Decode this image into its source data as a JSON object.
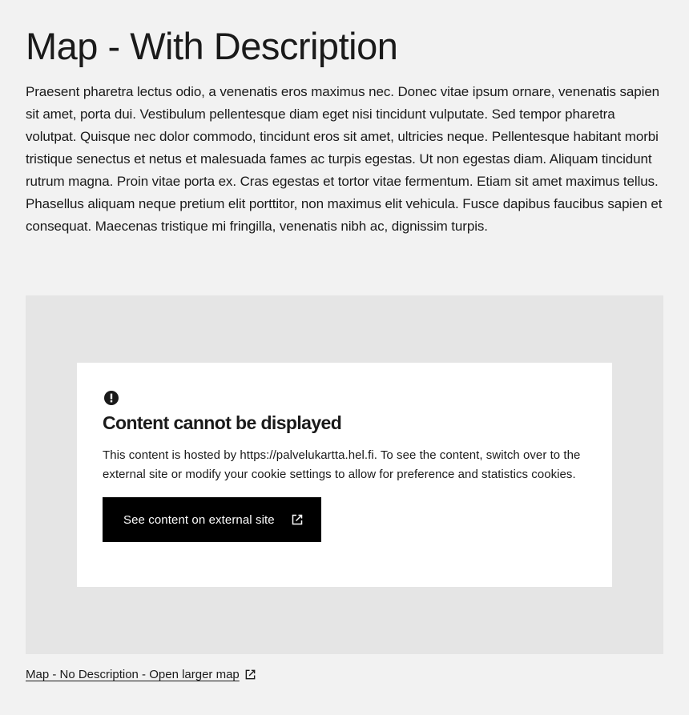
{
  "page": {
    "title": "Map - With Description",
    "description": "Praesent pharetra lectus odio, a venenatis eros maximus nec. Donec vitae ipsum ornare, venenatis sapien sit amet, porta dui. Vestibulum pellentesque diam eget nisi tincidunt vulputate. Sed tempor pharetra volutpat. Quisque nec dolor commodo, tincidunt eros sit amet, ultricies neque. Pellentesque habitant morbi tristique senectus et netus et malesuada fames ac turpis egestas. Ut non egestas diam. Aliquam tincidunt rutrum magna. Proin vitae porta ex. Cras egestas et tortor vitae fermentum. Etiam sit amet maximus tellus. Phasellus aliquam neque pretium elit porttitor, non maximus elit vehicula. Fusce dapibus faucibus sapien et consequat. Maecenas tristique mi fringilla, venenatis nibh ac, dignissim turpis."
  },
  "notice": {
    "icon": "alert-circle-icon",
    "title": "Content cannot be displayed",
    "text": "This content is hosted by https://palvelukartta.hel.fi. To see the content, switch over to the external site or modify your cookie settings to allow for preference and statistics cookies.",
    "button_label": "See content on external site",
    "button_icon": "external-link-icon"
  },
  "map_link": {
    "label": "Map - No Description - Open larger map",
    "icon": "external-link-icon"
  },
  "colors": {
    "page_background": "#f2f2f2",
    "map_placeholder_background": "#e5e5e5",
    "notice_background": "#ffffff",
    "button_background": "#000000",
    "button_text": "#ffffff",
    "text": "#1a1a1a"
  }
}
